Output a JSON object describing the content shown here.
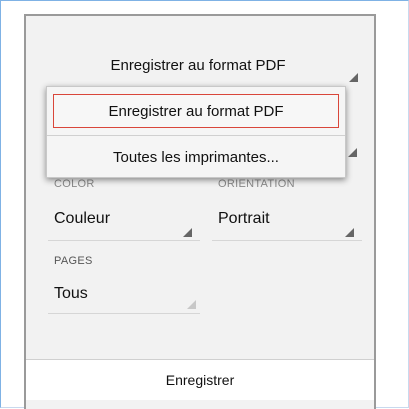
{
  "printer": {
    "selected": "Enregistrer au format PDF",
    "options": [
      "Enregistrer au format PDF",
      "Toutes les imprimantes..."
    ]
  },
  "color": {
    "label": "COLOR",
    "value": "Couleur"
  },
  "orientation": {
    "label": "ORIENTATION",
    "value": "Portrait"
  },
  "pages": {
    "label": "PAGES",
    "value": "Tous"
  },
  "footer": {
    "save_label": "Enregistrer"
  },
  "colors": {
    "highlight_border": "#d9463a",
    "frame_border": "#7fb2e5"
  }
}
